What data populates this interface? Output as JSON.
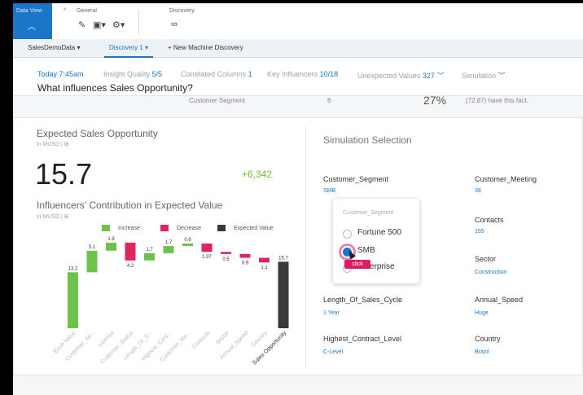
{
  "ribbon": {
    "data_view_label": "Data View",
    "general_label": "General",
    "discovery_label": "Discovery"
  },
  "tabs": {
    "dataset": "SalesDemoData ▾",
    "discovery": "Discovery 1 ▾",
    "new_discovery": "+ New Machine Discovery"
  },
  "info": {
    "today": "Today 7:45am",
    "insight_quality_label": "Insight Quality",
    "insight_quality_value": "5/5",
    "correlated_label": "Correlated Columns",
    "correlated_value": "1",
    "key_influencers_label": "Key Influencers",
    "key_influencers_value": "10/18",
    "unexpected_label": "Unexpected Values",
    "unexpected_value": "327",
    "simulation_label": "Simulation",
    "question": "What influences Sales Opportunity?"
  },
  "peek": {
    "left": "Customer Segment",
    "mid": "8",
    "big": "27%",
    "right": "(72.87) have this fact."
  },
  "expected": {
    "title": "Expected Sales Opportunity",
    "unit": "in MUSD | ⊞",
    "value": "15.7",
    "delta": "+6,342"
  },
  "influencers": {
    "title": "Influencers' Contribution in Expected Value",
    "unit": "in MUSD | ⊞",
    "legend_increase": "Increase",
    "legend_decrease": "Decrease",
    "legend_expected": "Expected Value"
  },
  "chart_data": {
    "type": "bar",
    "categories": [
      "Base Value",
      "Customer_Se...",
      "License",
      "Customer_Status",
      "Length_Of_S...",
      "Highest_Cont...",
      "Customer_Me...",
      "Contacts",
      "Sector",
      "Annual_Speed",
      "Country",
      "Sales Opportunity"
    ],
    "values": [
      13.2,
      5.1,
      1.9,
      -4.2,
      1.7,
      1.7,
      0.6,
      -1.97,
      -0.5,
      -0.9,
      -1.1,
      15.7
    ],
    "labels": [
      "13.2",
      "5.1",
      "1.9",
      "4.2",
      "1.7",
      "1.7",
      "0.6",
      "1.97",
      "0.5",
      "0.9",
      "1.1",
      "15.7"
    ],
    "colors": {
      "increase": "#6cc24a",
      "decrease": "#e0245e",
      "expected": "#3a3a3a"
    }
  },
  "simulation": {
    "title": "Simulation Selection",
    "fields": [
      {
        "name": "Customer_Segment",
        "value": "SMB"
      },
      {
        "name": "Customer_Meeting",
        "value": "38"
      },
      {
        "name": "Contacts",
        "value": "155"
      },
      {
        "name": "Sector",
        "value": "Construction"
      },
      {
        "name": "Length_Of_Sales_Cycle",
        "value": "1 Year"
      },
      {
        "name": "Annual_Speed",
        "value": "Huge"
      },
      {
        "name": "Highest_Contract_Level",
        "value": "C-Level"
      },
      {
        "name": "Country",
        "value": "Brazil"
      }
    ],
    "popup": {
      "title": "Customer_Segment",
      "options": [
        "Fortune 500",
        "SMB",
        "Enterprise"
      ],
      "selected": "SMB",
      "click_label": "click"
    }
  }
}
